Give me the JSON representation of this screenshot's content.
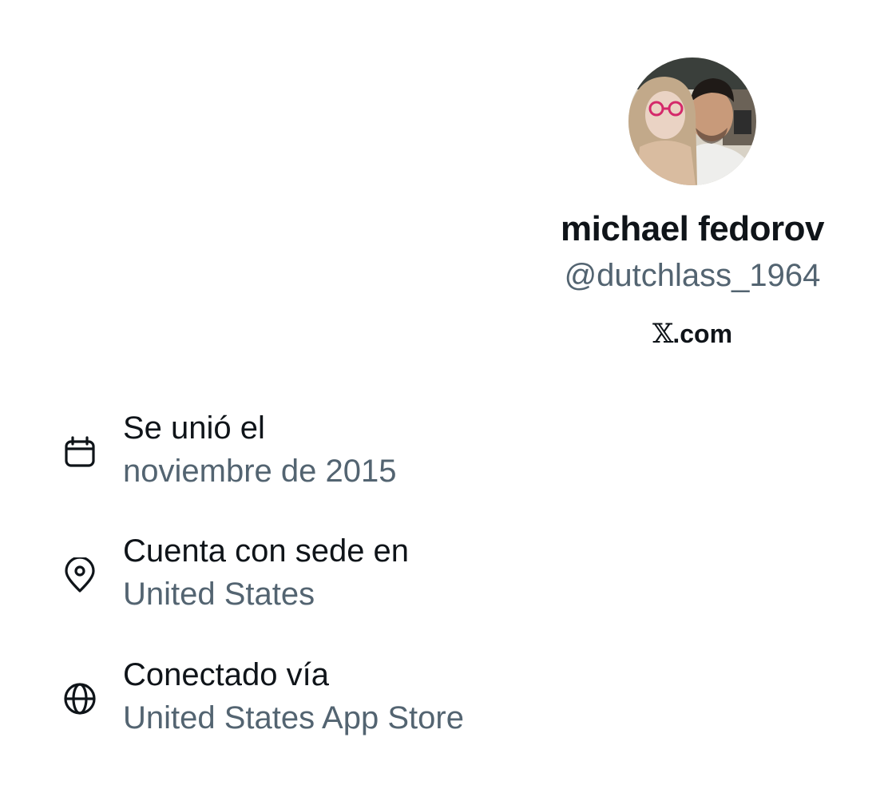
{
  "profile": {
    "avatar_icon": "profile-photo",
    "display_name": "michael fedorov",
    "handle": "@dutchlass_1964",
    "site_logo": "𝕏",
    "site_suffix": ".com"
  },
  "about": {
    "joined": {
      "icon": "calendar-icon",
      "label": "Se unió el",
      "value": "noviembre de 2015"
    },
    "location": {
      "icon": "location-pin-icon",
      "label": "Cuenta con sede en",
      "value": "United States"
    },
    "connected": {
      "icon": "globe-icon",
      "label": "Conectado vía",
      "value": "United States App Store"
    }
  },
  "colors": {
    "primary_text": "#0f1419",
    "secondary_text": "#536471",
    "background": "#ffffff"
  }
}
